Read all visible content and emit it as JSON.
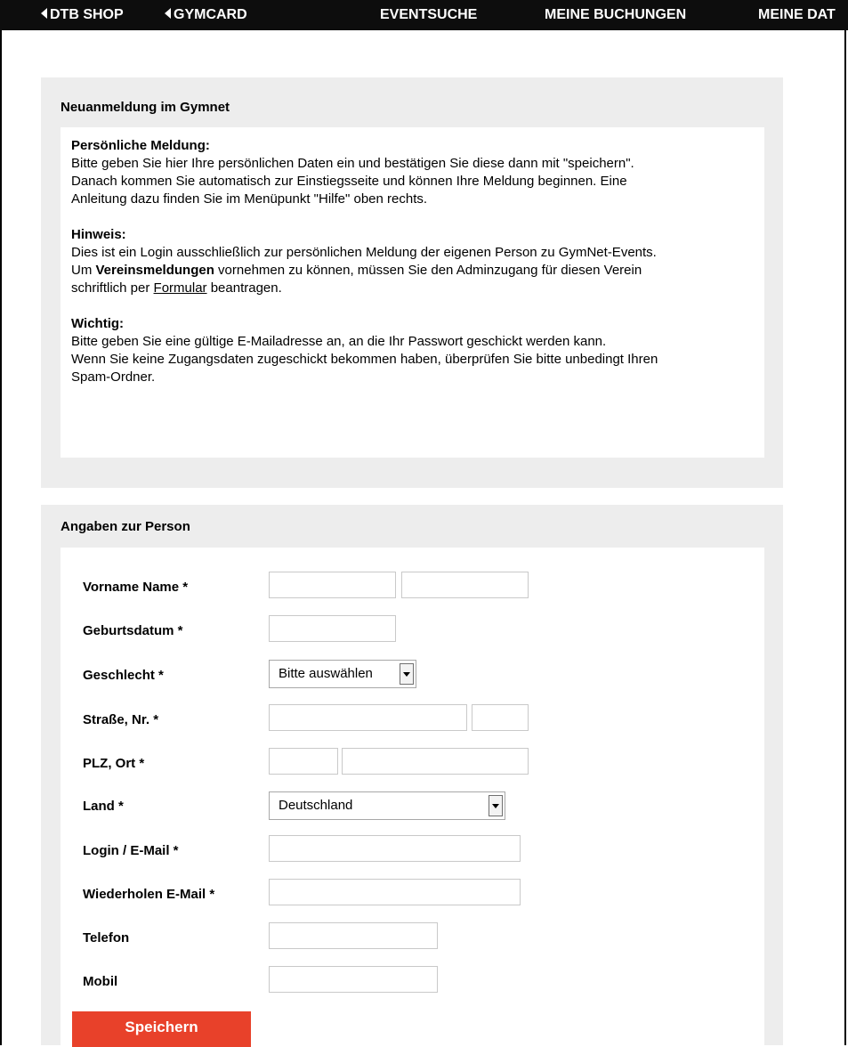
{
  "nav": {
    "items": [
      "DTB SHOP",
      "GYMCARD",
      "EVENTSUCHE",
      "MEINE BUCHUNGEN",
      "MEINE DAT"
    ]
  },
  "info": {
    "title": "Neuanmeldung im Gymnet",
    "p1_head": "Persönliche Meldung:",
    "p1_lines": [
      "Bitte geben Sie hier Ihre persönlichen Daten ein und bestätigen Sie diese dann mit \"speichern\".",
      "Danach kommen Sie automatisch zur Einstiegsseite und können Ihre Meldung beginnen. Eine",
      "Anleitung dazu finden Sie im Menüpunkt \"Hilfe\" oben rechts."
    ],
    "p2_head": "Hinweis:",
    "p2_line1": "Dies ist ein Login ausschließlich zur persönlichen Meldung der eigenen Person zu GymNet-Events.",
    "p2_line2_a": "Um ",
    "p2_line2_bold": "Vereinsmeldungen",
    "p2_line2_b": " vornehmen zu können, müssen Sie den Adminzugang für diesen Verein",
    "p2_line3_a": "schriftlich per ",
    "p2_line3_link": "Formular",
    "p2_line3_b": " beantragen.",
    "p3_head": "Wichtig:",
    "p3_lines": [
      "Bitte geben Sie eine gültige E-Mailadresse an, an die Ihr Passwort geschickt werden kann.",
      "Wenn Sie keine Zugangsdaten zugeschickt bekommen haben, überprüfen Sie bitte unbedingt Ihren",
      "Spam-Ordner."
    ]
  },
  "form": {
    "title": "Angaben zur Person",
    "labels": {
      "name": "Vorname Name *",
      "birthdate": "Geburtsdatum *",
      "gender": "Geschlecht *",
      "street": "Straße, Nr. *",
      "plz": "PLZ, Ort *",
      "country": "Land *",
      "login": "Login / E-Mail *",
      "repeat_email": "Wiederholen E-Mail *",
      "phone": "Telefon",
      "mobile": "Mobil"
    },
    "gender_selected": "Bitte auswählen",
    "country_selected": "Deutschland",
    "save_label": "Speichern"
  }
}
